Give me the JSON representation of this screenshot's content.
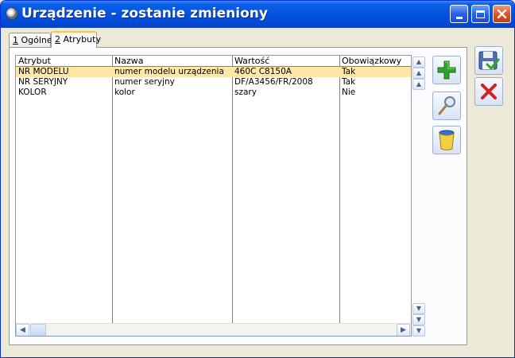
{
  "window": {
    "title": "Urządzenie - zostanie zmieniony"
  },
  "tabs": [
    {
      "key": "1",
      "label": " Ogólne"
    },
    {
      "key": "2",
      "label": " Atrybuty"
    }
  ],
  "grid": {
    "headers": [
      "Atrybut",
      "Nazwa",
      "Wartość",
      "Obowiązkowy"
    ],
    "rows": [
      {
        "atrybut": "NR MODELU",
        "nazwa": "numer modelu urządzenia",
        "wartosc": "460C C8150A",
        "obowiazkowy": "Tak"
      },
      {
        "atrybut": "NR SERYJNY",
        "nazwa": "numer seryjny",
        "wartosc": "DF/A3456/FR/2008",
        "obowiazkowy": "Tak"
      },
      {
        "atrybut": "KOLOR",
        "nazwa": "kolor",
        "wartosc": "szary",
        "obowiazkowy": "Nie"
      }
    ]
  },
  "colors": {
    "selection": "#ffe8a6",
    "titlebar": "#0454e0",
    "add_icon": "#2ea62e",
    "cancel_icon": "#d41f1f"
  },
  "icons": {
    "add": "plus-icon",
    "search": "magnifier-icon",
    "delete": "trash-icon",
    "save": "floppy-disk-icon",
    "cancel": "x-icon"
  }
}
